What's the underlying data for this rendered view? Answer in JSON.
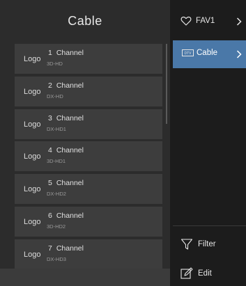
{
  "left_panel": {
    "title": "Cable",
    "channels": [
      {
        "logo": "Logo",
        "number": "1",
        "name": "Channel",
        "sub": "3D-HD"
      },
      {
        "logo": "Logo",
        "number": "2",
        "name": "Channel",
        "sub": "DX-HD"
      },
      {
        "logo": "Logo",
        "number": "3",
        "name": "Channel",
        "sub": "DX-HD1"
      },
      {
        "logo": "Logo",
        "number": "4",
        "name": "Channel",
        "sub": "3D-HD1"
      },
      {
        "logo": "Logo",
        "number": "5",
        "name": "Channel",
        "sub": "DX-HD2"
      },
      {
        "logo": "Logo",
        "number": "6",
        "name": "Channel",
        "sub": "3D-HD2"
      },
      {
        "logo": "Logo",
        "number": "7",
        "name": "Channel",
        "sub": "DX-HD3"
      }
    ]
  },
  "right_panel": {
    "fav": {
      "label": "FAV1",
      "icon": "heart-icon"
    },
    "source": {
      "label": "Cable",
      "icon": "dtv-icon"
    },
    "filter": {
      "label": "Filter",
      "icon": "filter-icon"
    },
    "edit": {
      "label": "Edit",
      "icon": "edit-icon"
    }
  },
  "colors": {
    "selected": "#4a78a8",
    "left_bg": "#2c2c2c",
    "right_bg": "#1c1c1c",
    "item_bg": "#3d3d3d"
  }
}
